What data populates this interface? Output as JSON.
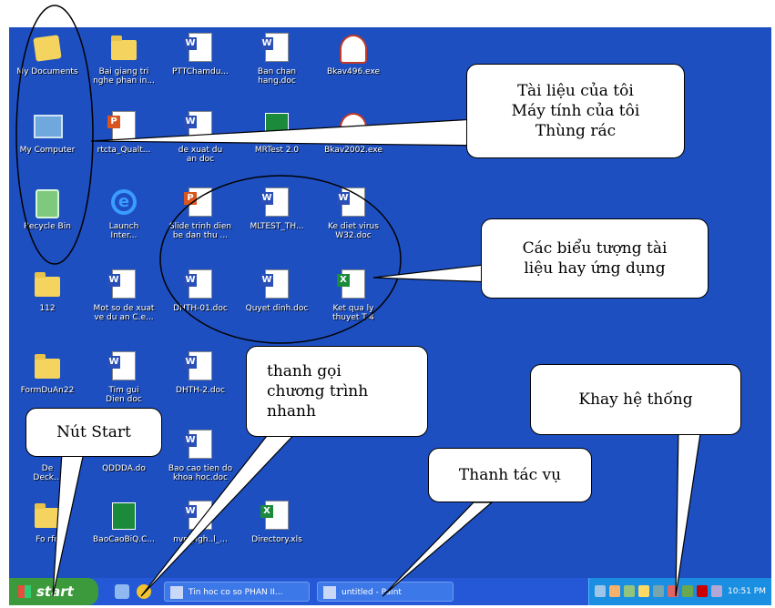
{
  "desktop": {
    "icons": [
      {
        "label": "My Documents",
        "icon": "my-documents-icon"
      },
      {
        "label": "My Computer",
        "icon": "my-computer-icon"
      },
      {
        "label": "Recycle Bin",
        "icon": "recycle-bin-icon"
      },
      {
        "label": "112",
        "icon": "folder-icon"
      },
      {
        "label": "FormDuAn22",
        "icon": "folder-icon"
      },
      {
        "label": "De\nDeck...",
        "icon": "folder-icon"
      },
      {
        "label": "Fo rfo",
        "icon": "folder-icon"
      },
      {
        "label": "Bai giang tri\nnghe phan in...",
        "icon": "folder-icon"
      },
      {
        "label": "rtcta_Qualt...",
        "icon": "powerpoint-doc-icon"
      },
      {
        "label": "Launch\nInter...",
        "icon": "internet-explorer-icon"
      },
      {
        "label": "Mot so de xuat\nve du an C.e...",
        "icon": "word-doc-icon"
      },
      {
        "label": "Tim gui\nDien doc",
        "icon": "word-doc-icon"
      },
      {
        "label": "QDDDA.do",
        "icon": "folder-icon"
      },
      {
        "label": "BaoCaoBiQ.C...",
        "icon": "excel-doc-icon"
      },
      {
        "label": "PTTChamdu...",
        "icon": "word-doc-icon"
      },
      {
        "label": "de xuat du\nan doc",
        "icon": "word-doc-icon"
      },
      {
        "label": "Slide trinh dien\nbe dan thu ...",
        "icon": "powerpoint-doc-icon"
      },
      {
        "label": "DHTH-01.doc",
        "icon": "word-doc-icon"
      },
      {
        "label": "DHTH-2.doc",
        "icon": "word-doc-icon"
      },
      {
        "label": "Bao cao tien do\nkhoa hoc.doc",
        "icon": "word-doc-icon"
      },
      {
        "label": "nvn_ngh..l_...",
        "icon": "word-doc-icon"
      },
      {
        "label": "Ban chan\nhang.doc",
        "icon": "word-doc-icon"
      },
      {
        "label": "MRTest 2.0",
        "icon": "app-icon"
      },
      {
        "label": "MLTEST_TH...",
        "icon": "word-doc-icon"
      },
      {
        "label": "Quyet dinh.doc",
        "icon": "word-doc-icon"
      },
      {
        "label": "Directory.xls",
        "icon": "excel-doc-icon"
      },
      {
        "label": "Bkav496.exe",
        "icon": "bkav-icon"
      },
      {
        "label": "Bkav2002.exe",
        "icon": "bkav-icon"
      },
      {
        "label": "Ke diet virus\nW32.doc",
        "icon": "word-doc-icon"
      },
      {
        "label": "Ket qua ly\nthuyet T-4",
        "icon": "excel-doc-icon"
      }
    ]
  },
  "taskbar": {
    "start_label": "start",
    "tasks": [
      {
        "label": "Tin hoc co so PHAN II..."
      },
      {
        "label": "untitled - Paint"
      }
    ],
    "clock": "10:51 PM"
  },
  "callouts": {
    "desktop_items": "Tài liệu của tôi\nMáy tính của tôi\nThùng rác",
    "doc_icons": "Các biểu tượng tài\nliệu hay ứng dụng",
    "quick_launch": "thanh gọi\nchương trình\nnhanh",
    "system_tray": "Khay hệ thống",
    "start_button": "Nút Start",
    "taskbar": "Thanh tác vụ"
  }
}
